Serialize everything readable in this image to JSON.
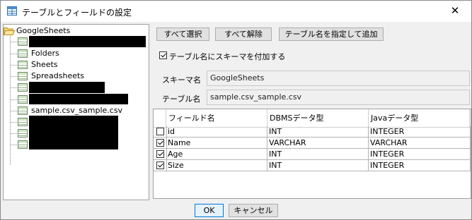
{
  "window": {
    "title": "テーブルとフィールドの設定",
    "close_glyph": "✕"
  },
  "tree": {
    "root_label": "GoogleSheets",
    "items": [
      {
        "label": "",
        "redacted": true
      },
      {
        "label": "Folders"
      },
      {
        "label": "Sheets"
      },
      {
        "label": "Spreadsheets"
      },
      {
        "label": "",
        "redacted": true
      },
      {
        "label": "",
        "redacted": true
      },
      {
        "label": "sample.csv_sample.csv"
      },
      {
        "label": "",
        "redacted": true
      },
      {
        "label": "",
        "redacted": true
      },
      {
        "label": "",
        "redacted": true
      }
    ]
  },
  "toolbar": {
    "select_all": "すべて選択",
    "deselect_all": "すべて解除",
    "add_by_name": "テーブル名を指定して追加"
  },
  "options": {
    "add_schema_label": "テーブル名にスキーマを付加する",
    "add_schema_checked": true
  },
  "form": {
    "schema_label": "スキーマ名",
    "schema_value": "GoogleSheets",
    "table_label": "テーブル名",
    "table_value": "sample.csv_sample.csv"
  },
  "grid": {
    "columns": [
      "フィールド名",
      "DBMSデータ型",
      "Javaデータ型"
    ],
    "rows": [
      {
        "checked": false,
        "name": "id",
        "dbms": "INT",
        "java": "INTEGER"
      },
      {
        "checked": true,
        "name": "Name",
        "dbms": "VARCHAR",
        "java": "VARCHAR"
      },
      {
        "checked": true,
        "name": "Age",
        "dbms": "INT",
        "java": "INTEGER"
      },
      {
        "checked": true,
        "name": "Size",
        "dbms": "INT",
        "java": "INTEGER"
      }
    ]
  },
  "footer": {
    "ok": "OK",
    "cancel": "キャンセル"
  }
}
